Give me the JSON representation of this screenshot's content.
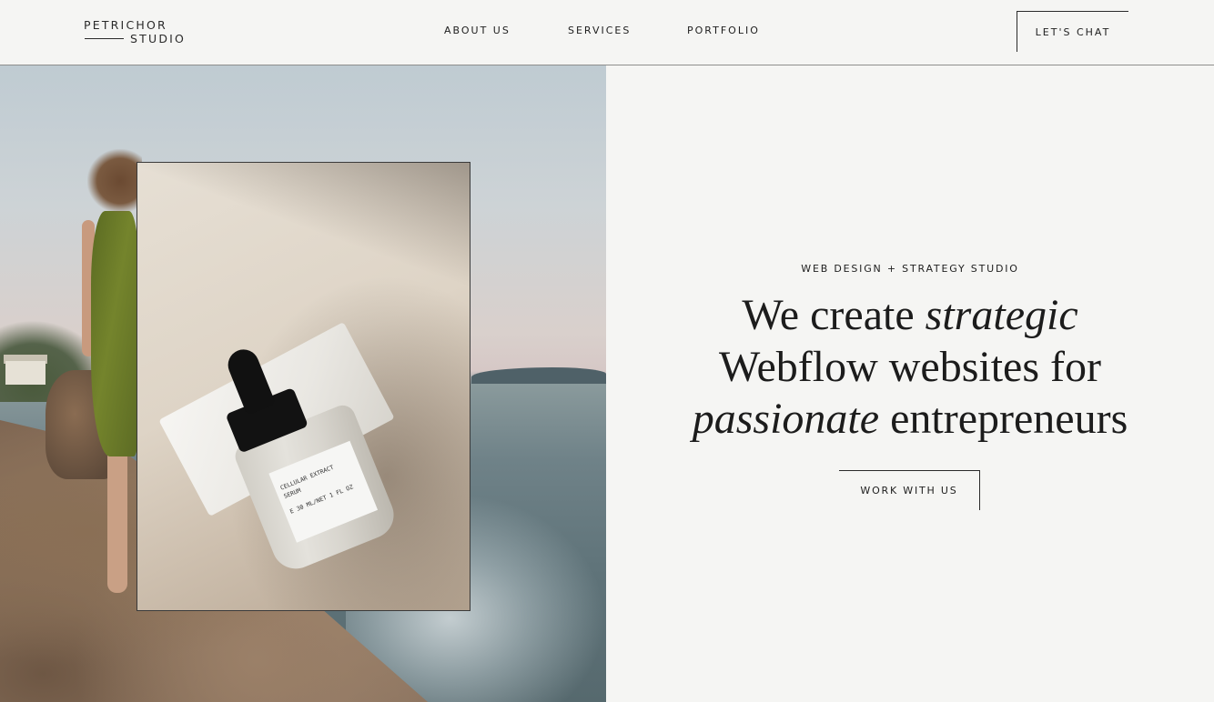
{
  "header": {
    "logo": {
      "line1": "PETRICHOR",
      "line2": "STUDIO"
    },
    "nav": [
      {
        "label": "ABOUT US"
      },
      {
        "label": "SERVICES"
      },
      {
        "label": "PORTFOLIO"
      }
    ],
    "cta_label": "LET'S CHAT"
  },
  "hero": {
    "eyebrow": "WEB DESIGN + STRATEGY STUDIO",
    "headline": {
      "line1_plain": "We create ",
      "line1_italic": "strategic",
      "line2_plain": "Webflow websites for",
      "line3_italic": "passionate",
      "line3_plain": " entrepreneurs"
    },
    "button_label": "WORK WITH US"
  },
  "product_label": {
    "line1": "CELLULAR EXTRACT",
    "line2": "SERUM",
    "line3": "E 30 ML/NET 1 FL OZ"
  },
  "colors": {
    "background": "#f5f5f3",
    "text": "#1c1c1c",
    "border": "#2a2a2a"
  }
}
